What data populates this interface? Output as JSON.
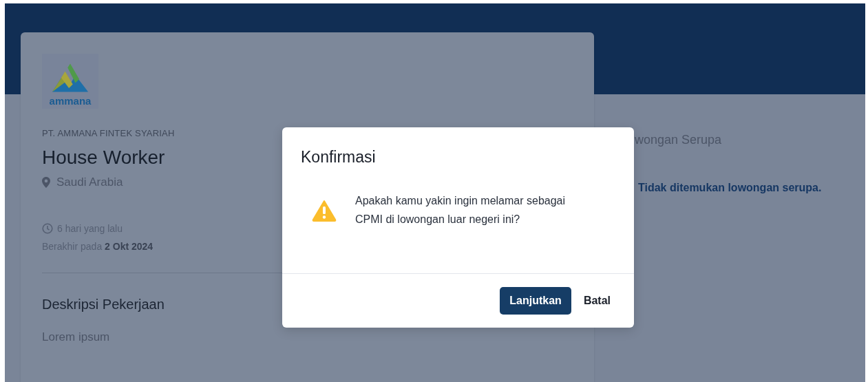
{
  "job": {
    "company_logo_text": "ammana",
    "company": "PT. AMMANA FINTEK SYARIAH",
    "title": "House Worker",
    "location": "Saudi Arabia",
    "posted": "6 hari yang lalu",
    "deadline": "Berakhir pada **2 Okt 2024**",
    "description_heading": "Deskripsi Pekerjaan",
    "description": "Lorem ipsum"
  },
  "similar": {
    "heading": "wongan Serupa",
    "empty_message": "Tidak ditemukan lowongan serupa."
  },
  "dialog": {
    "title": "Konfirmasi",
    "message": "Apakah kamu yakin ingin melamar sebagai CPMI di lowongan luar negeri ini?",
    "buttons": [
      {
        "label": "Lanjutkan",
        "kind": "primary"
      },
      {
        "label": "Batal",
        "kind": "text"
      }
    ]
  }
}
